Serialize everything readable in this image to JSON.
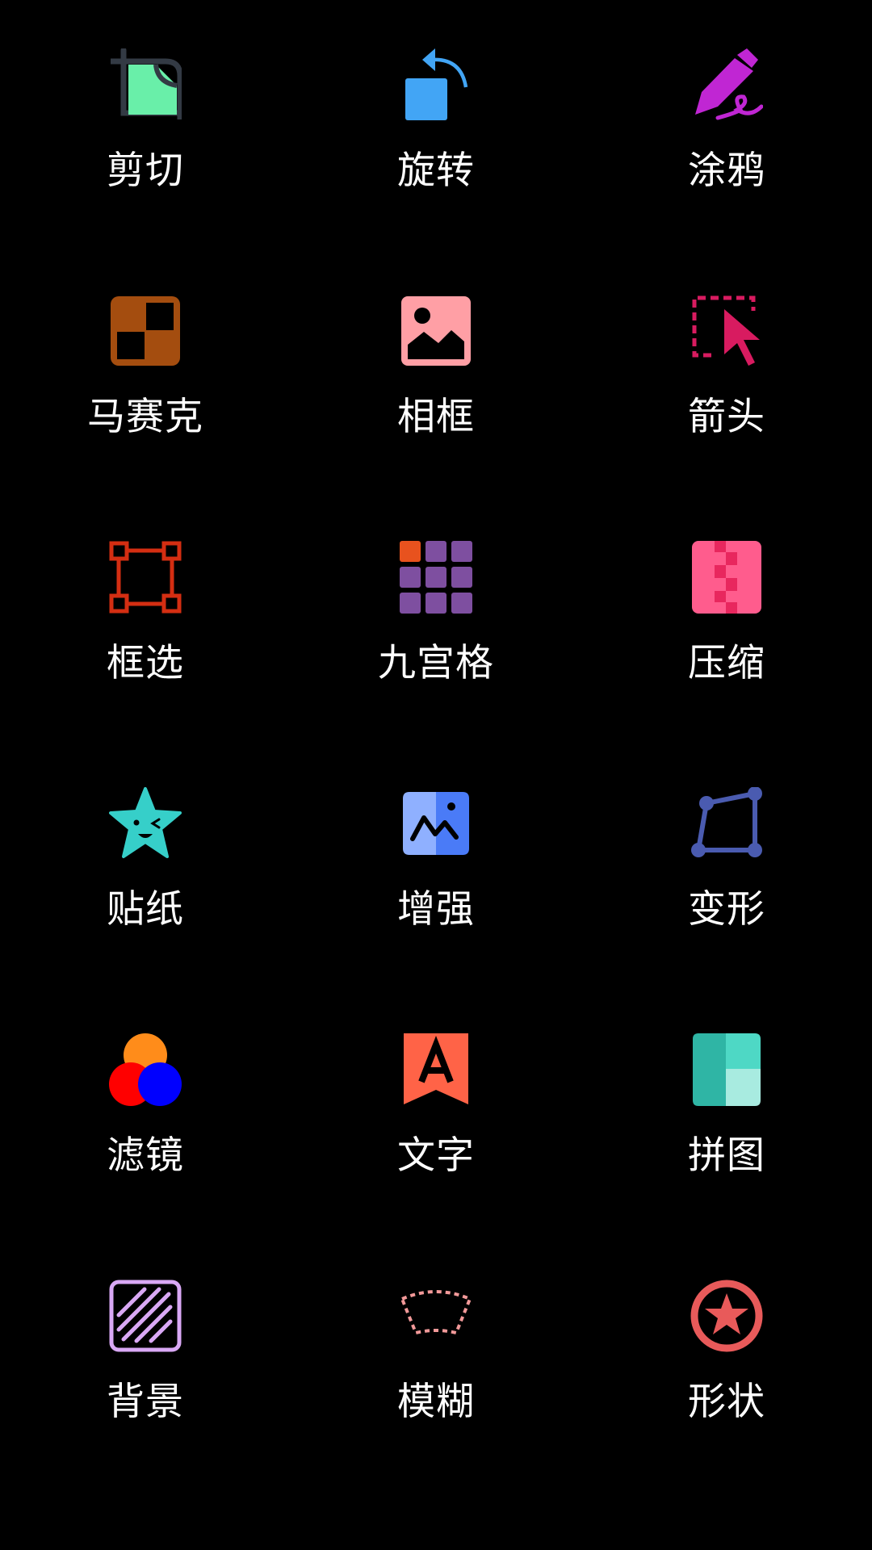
{
  "tools": [
    {
      "id": "crop",
      "label": "剪切",
      "icon": "crop-icon",
      "color": "#69EFA9"
    },
    {
      "id": "rotate",
      "label": "旋转",
      "icon": "rotate-icon",
      "color": "#42A5F5"
    },
    {
      "id": "doodle",
      "label": "涂鸦",
      "icon": "pencil-icon",
      "color": "#C026D3"
    },
    {
      "id": "mosaic",
      "label": "马赛克",
      "icon": "mosaic-icon",
      "color": "#A44D0F"
    },
    {
      "id": "frame",
      "label": "相框",
      "icon": "image-frame-icon",
      "color": "#FF9FA5"
    },
    {
      "id": "arrow",
      "label": "箭头",
      "icon": "arrow-cursor-icon",
      "color": "#D81B60"
    },
    {
      "id": "select",
      "label": "框选",
      "icon": "selection-box-icon",
      "color": "#D42E12"
    },
    {
      "id": "nine-grid",
      "label": "九宫格",
      "icon": "nine-grid-icon",
      "color": "#7E4FA0"
    },
    {
      "id": "compress",
      "label": "压缩",
      "icon": "zip-icon",
      "color": "#FF5C8D"
    },
    {
      "id": "sticker",
      "label": "贴纸",
      "icon": "star-sticker-icon",
      "color": "#36CFC9"
    },
    {
      "id": "enhance",
      "label": "增强",
      "icon": "enhance-icon",
      "color": "#4A7BF7"
    },
    {
      "id": "transform",
      "label": "变形",
      "icon": "transform-icon",
      "color": "#4A5BB0"
    },
    {
      "id": "filter",
      "label": "滤镜",
      "icon": "color-filter-icon",
      "color": "#FF8C1A"
    },
    {
      "id": "text",
      "label": "文字",
      "icon": "text-icon",
      "color": "#FF6347"
    },
    {
      "id": "collage",
      "label": "拼图",
      "icon": "collage-icon",
      "color": "#2FB5A5"
    },
    {
      "id": "background",
      "label": "背景",
      "icon": "background-pattern-icon",
      "color": "#D9A8F5"
    },
    {
      "id": "blur",
      "label": "模糊",
      "icon": "blur-icon",
      "color": "#F29999"
    },
    {
      "id": "shape",
      "label": "形状",
      "icon": "star-circle-icon",
      "color": "#E85A5A"
    }
  ]
}
